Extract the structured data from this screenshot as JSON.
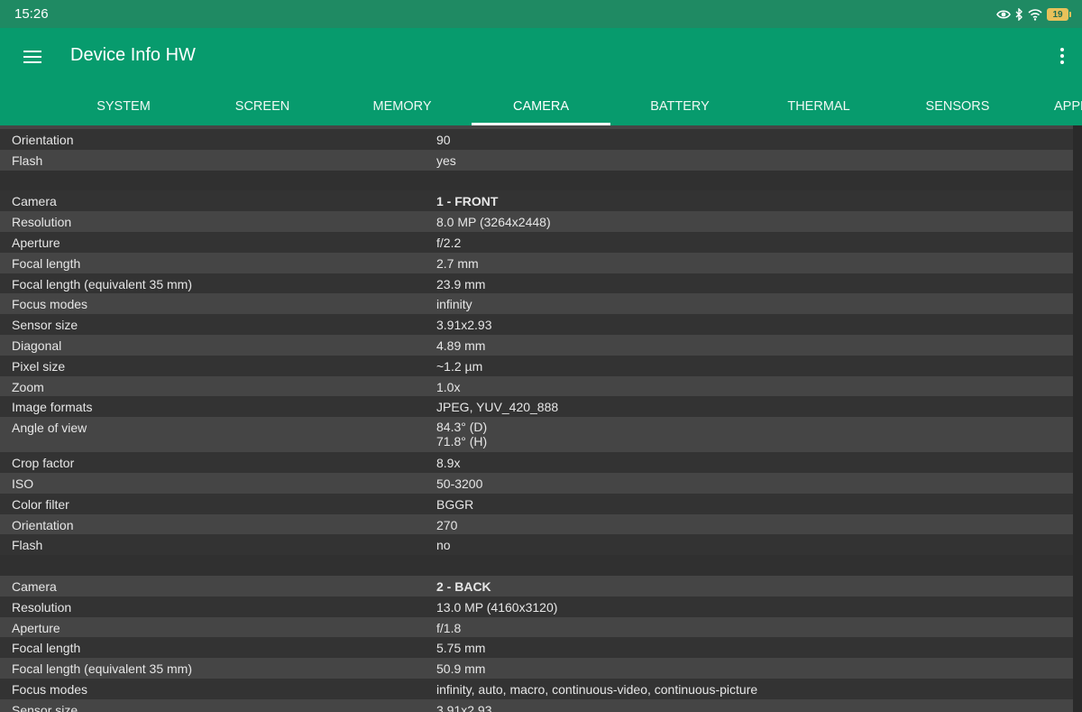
{
  "statusbar": {
    "time": "15:26",
    "battery_level": "19"
  },
  "app": {
    "title": "Device Info HW"
  },
  "tabs": [
    "SYSTEM",
    "SCREEN",
    "MEMORY",
    "CAMERA",
    "BATTERY",
    "THERMAL",
    "SENSORS",
    "APPL"
  ],
  "active_tab": "CAMERA",
  "rows": [
    {
      "key": "",
      "value": "",
      "partial": true
    },
    {
      "key": "Orientation",
      "value": "90"
    },
    {
      "key": "Flash",
      "value": "yes"
    },
    {
      "key": "",
      "value": "",
      "blank": true
    },
    {
      "key": "Camera",
      "value": "1 - FRONT",
      "bold": true
    },
    {
      "key": "Resolution",
      "value": "8.0 MP (3264x2448)"
    },
    {
      "key": "Aperture",
      "value": "f/2.2"
    },
    {
      "key": "Focal length",
      "value": "2.7 mm"
    },
    {
      "key": "Focal length (equivalent 35 mm)",
      "value": "23.9 mm"
    },
    {
      "key": "Focus modes",
      "value": "infinity"
    },
    {
      "key": "Sensor size",
      "value": "3.91x2.93"
    },
    {
      "key": "Diagonal",
      "value": "4.89 mm"
    },
    {
      "key": "Pixel size",
      "value": "~1.2 µm"
    },
    {
      "key": "Zoom",
      "value": "1.0x"
    },
    {
      "key": "Image formats",
      "value": "JPEG, YUV_420_888"
    },
    {
      "key": "Angle of view",
      "value": "84.3° (D)\n71.8° (H)",
      "multi": true
    },
    {
      "key": "Crop factor",
      "value": "8.9x"
    },
    {
      "key": "ISO",
      "value": "50-3200"
    },
    {
      "key": "Color filter",
      "value": "BGGR"
    },
    {
      "key": "Orientation",
      "value": "270"
    },
    {
      "key": "Flash",
      "value": "no"
    },
    {
      "key": "",
      "value": "",
      "blank": true
    },
    {
      "key": "Camera",
      "value": "2 - BACK",
      "bold": true
    },
    {
      "key": "Resolution",
      "value": "13.0 MP (4160x3120)"
    },
    {
      "key": "Aperture",
      "value": "f/1.8"
    },
    {
      "key": "Focal length",
      "value": "5.75 mm"
    },
    {
      "key": "Focal length (equivalent 35 mm)",
      "value": "50.9 mm"
    },
    {
      "key": "Focus modes",
      "value": "infinity, auto, macro, continuous-video, continuous-picture"
    },
    {
      "key": "Sensor size",
      "value": "3.91x2.93"
    }
  ]
}
